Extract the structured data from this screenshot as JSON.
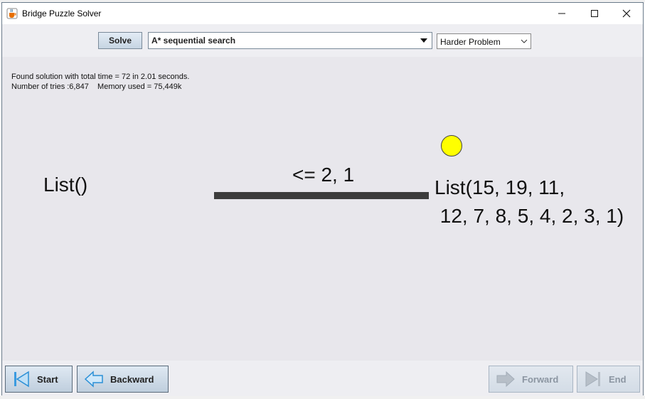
{
  "window": {
    "title": "Bridge Puzzle Solver"
  },
  "toolbar": {
    "solve_label": "Solve",
    "algorithm": "A* sequential search",
    "problem": "Harder Problem"
  },
  "status": {
    "line1": "Found solution with total time = 72 in 2.01 seconds.",
    "line2": "Number of tries :6,847    Memory used = 75,449k"
  },
  "scene": {
    "left_list": "List()",
    "bridge_label": "<= 2, 1",
    "right_list": "List(15, 19, 11,\n 12, 7, 8, 5, 4, 2, 3, 1)",
    "lamp_color": "#ffff00"
  },
  "footer": {
    "start_label": "Start",
    "backward_label": "Backward",
    "forward_label": "Forward",
    "end_label": "End"
  },
  "colors": {
    "accent": "#2a8fd6",
    "bridge": "#3c3c3c"
  },
  "icons": {
    "app": "java-coffee-icon",
    "start": "skip-to-start-icon",
    "backward": "arrow-left-icon",
    "forward": "arrow-right-icon",
    "end": "skip-to-end-icon"
  }
}
